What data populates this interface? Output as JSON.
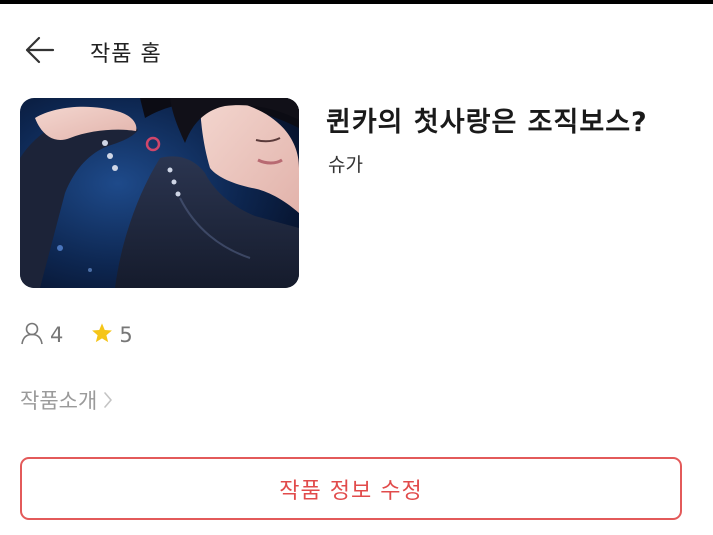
{
  "header": {
    "back_icon": "arrow-left-icon",
    "title": "작품 홈"
  },
  "work": {
    "cover_image": "performer-on-stage-photo",
    "title": "퀸카의 첫사랑은 조직보스?",
    "author": "슈가"
  },
  "stats": {
    "readers_icon": "person-icon",
    "readers": "4",
    "rating_icon": "star-icon",
    "rating": "5",
    "rating_color": "#f5c518"
  },
  "intro": {
    "label": "작품소개",
    "chevron_icon": "chevron-right-icon"
  },
  "edit_button": {
    "label": "작품 정보 수정",
    "accent": "#e35a5a"
  }
}
